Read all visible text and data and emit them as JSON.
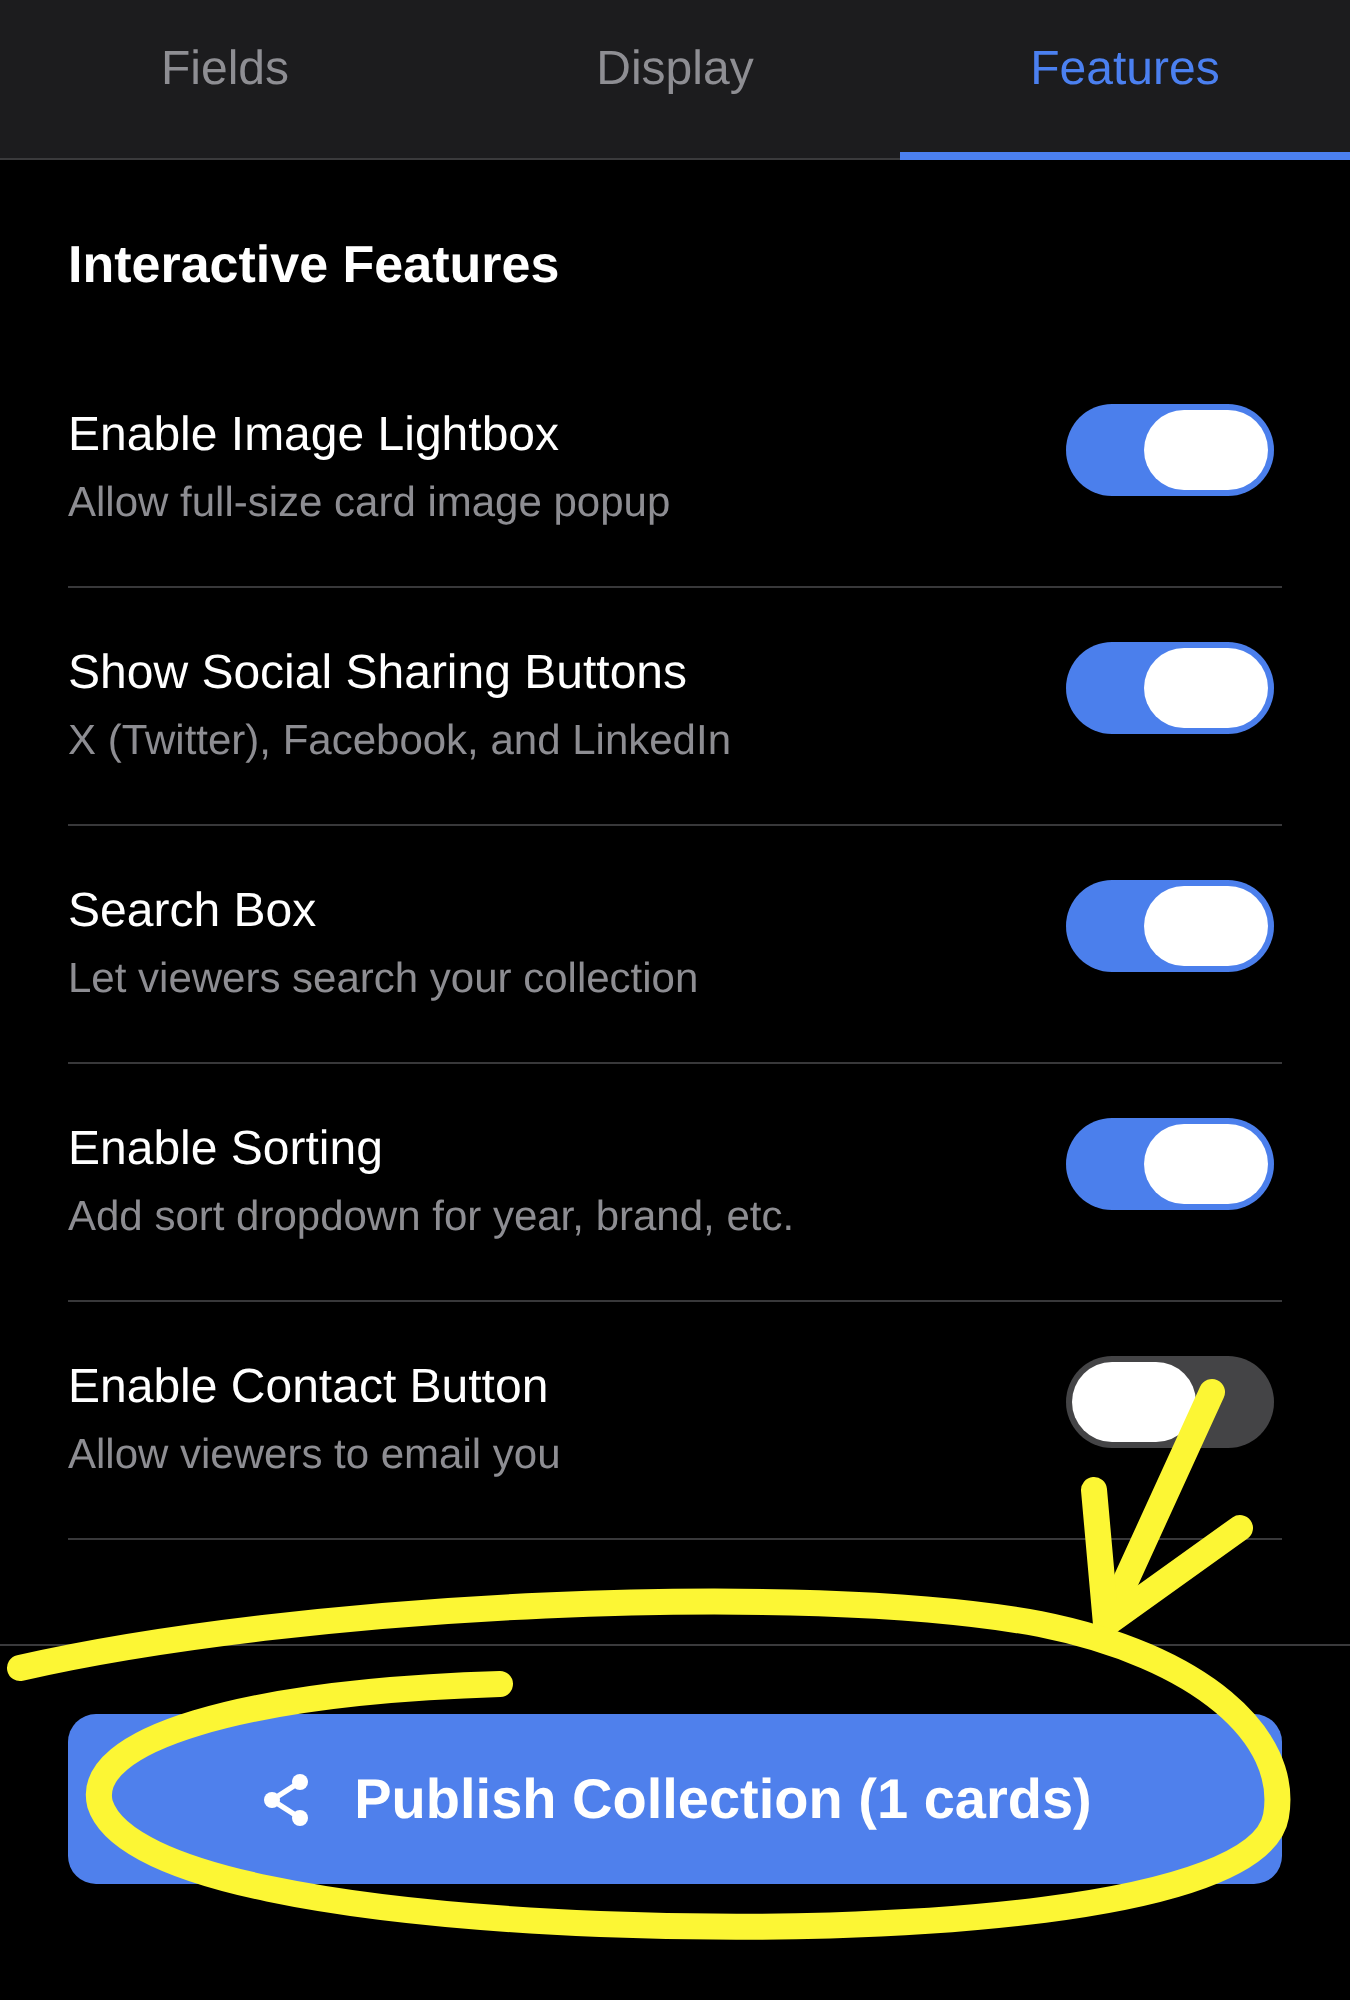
{
  "tabs": [
    {
      "label": "Fields",
      "selected": false
    },
    {
      "label": "Display",
      "selected": false
    },
    {
      "label": "Features",
      "selected": true
    }
  ],
  "section": {
    "title": "Interactive Features",
    "settings": [
      {
        "title": "Enable Image Lightbox",
        "description": "Allow full-size card image popup",
        "on": true
      },
      {
        "title": "Show Social Sharing Buttons",
        "description": "X (Twitter), Facebook, and LinkedIn",
        "on": true
      },
      {
        "title": "Search Box",
        "description": "Let viewers search your collection",
        "on": true
      },
      {
        "title": "Enable Sorting",
        "description": "Add sort dropdown for year, brand, etc.",
        "on": true
      },
      {
        "title": "Enable Contact Button",
        "description": "Allow viewers to email you",
        "on": false
      }
    ]
  },
  "publish_button": {
    "label": "Publish Collection (1 cards)"
  }
}
